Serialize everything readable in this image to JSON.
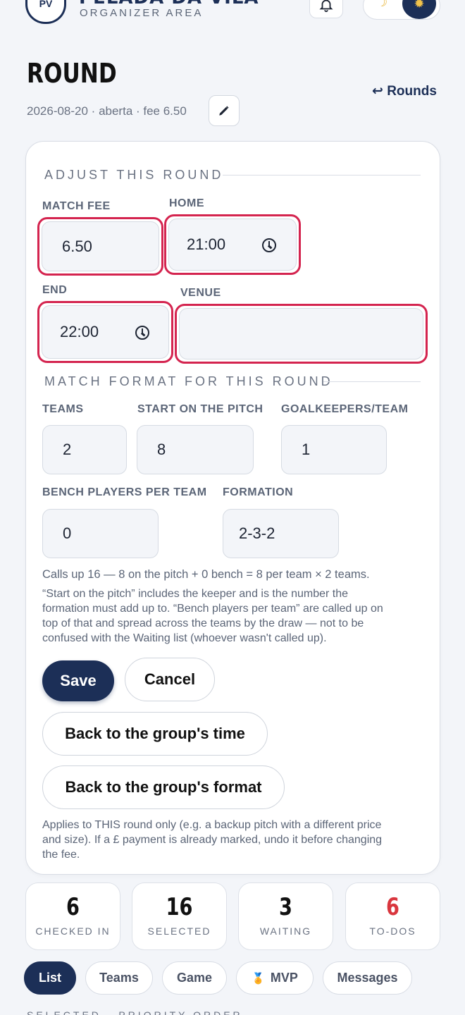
{
  "header": {
    "brand_name": "PELADA DA VILA",
    "brand_sub": "ORGANIZER AREA",
    "logo_initials": "PV"
  },
  "page": {
    "title": "ROUND",
    "back_link": "↩ Rounds",
    "meta": "2026-08-20 · aberta · fee 6.50"
  },
  "adjust": {
    "heading": "ADJUST THIS ROUND",
    "match_fee_label": "MATCH FEE",
    "match_fee_value": "6.50",
    "home_label": "HOME",
    "home_value": "21:00",
    "end_label": "END",
    "end_value": "22:00",
    "venue_label": "VENUE",
    "venue_value": ""
  },
  "format": {
    "heading": "MATCH FORMAT FOR THIS ROUND",
    "teams_label": "TEAMS",
    "teams_value": "2",
    "start_label": "START ON THE PITCH",
    "start_value": "8",
    "gk_label": "GOALKEEPERS/TEAM",
    "gk_value": "1",
    "bench_label": "BENCH PLAYERS PER TEAM",
    "bench_value": "0",
    "formation_label": "FORMATION",
    "formation_value": "2-3-2",
    "summary": "Calls up 16 — 8 on the pitch + 0 bench = 8 per team × 2 teams.",
    "help_line1": "“Start on the pitch” includes the keeper and is the number the",
    "help_line2": "formation must add up to. “Bench players per team” are called up on",
    "help_line3": "top of that and spread across the teams by the draw — not to be",
    "help_line4": "confused with the Waiting list (whoever wasn't called up)."
  },
  "actions": {
    "save": "Save",
    "cancel": "Cancel",
    "back_time": "Back to the group's time",
    "back_format": "Back to the group's format",
    "note_line1": "Applies to THIS round only (e.g. a backup pitch with a different price",
    "note_line2": "and size). If a £ payment is already marked, undo it before changing",
    "note_line3": "the fee."
  },
  "stats": [
    {
      "value": "6",
      "label": "CHECKED IN"
    },
    {
      "value": "16",
      "label": "SELECTED"
    },
    {
      "value": "3",
      "label": "WAITING"
    },
    {
      "value": "6",
      "label": "TO-DOS"
    }
  ],
  "tabs": [
    {
      "label": "List"
    },
    {
      "label": "Teams"
    },
    {
      "label": "Game"
    },
    {
      "label": "MVP"
    },
    {
      "label": "Messages"
    }
  ],
  "footer_peek": "SELECTED · PRIORITY ORDER",
  "colors": {
    "navy": "#1c2f57",
    "error_border": "#d4244f",
    "todo_red": "#d9363e"
  }
}
